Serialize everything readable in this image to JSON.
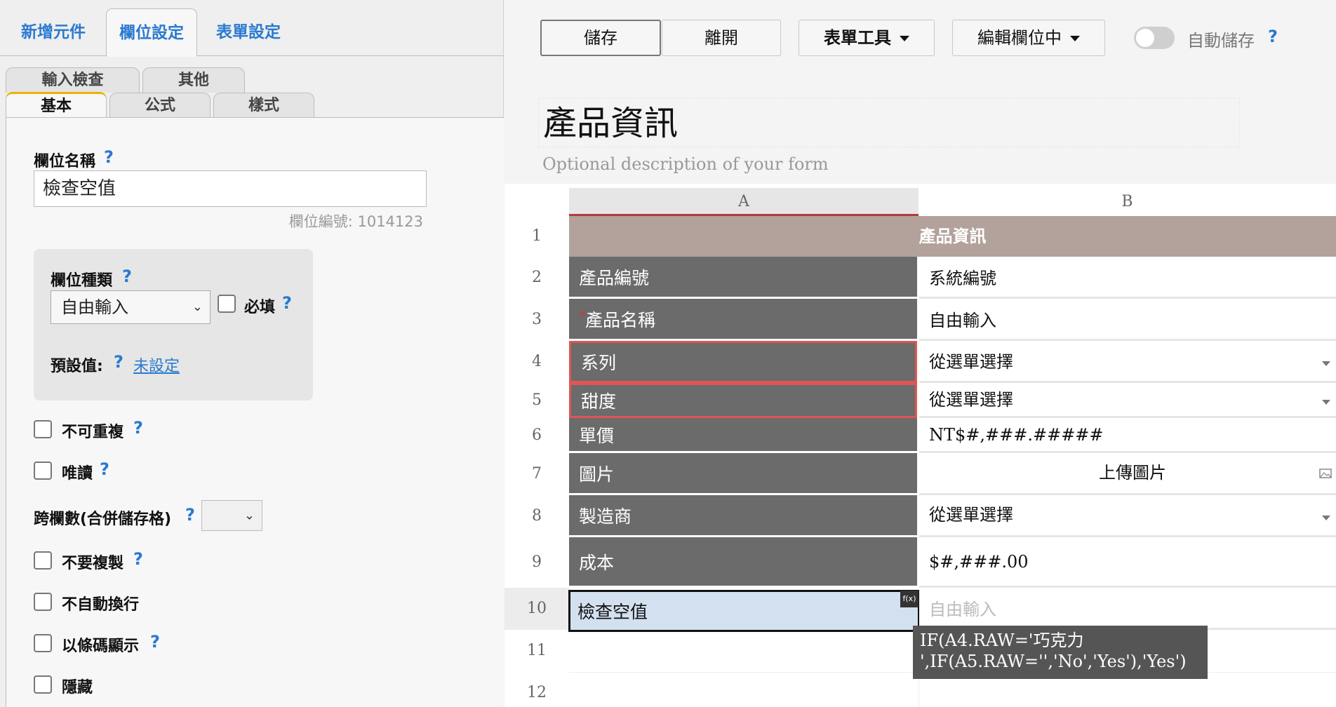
{
  "left_panel": {
    "top_tabs": [
      "新增元件",
      "欄位設定",
      "表單設定"
    ],
    "sub_tabs_row1": [
      "輸入檢查",
      "其他"
    ],
    "sub_tabs_row2": [
      "基本",
      "公式",
      "樣式"
    ],
    "field_name_label": "欄位名稱",
    "field_name_value": "檢查空值",
    "field_id": "欄位編號: 1014123",
    "field_type_label": "欄位種類",
    "field_type_value": "自由輸入",
    "required_label": "必填",
    "default_label": "預設值:",
    "default_value": "未設定",
    "checkboxes": [
      "不可重複",
      "唯讀"
    ],
    "colspan_label": "跨欄數(合併儲存格)",
    "checkboxes2": [
      "不要複製",
      "不自動換行",
      "以條碼顯示",
      "隱藏"
    ],
    "help": "?"
  },
  "toolbar": {
    "save": "儲存",
    "leave": "離開",
    "form_tools": "表單工具",
    "edit_mode": "編輯欄位中",
    "autosave": "自動儲存",
    "help": "?"
  },
  "form": {
    "title": "產品資訊",
    "description": "Optional description of your form"
  },
  "sheet": {
    "columns": [
      "A",
      "B"
    ],
    "header_row": "產品資訊",
    "rows": [
      {
        "num": "1"
      },
      {
        "num": "2",
        "a": "產品編號",
        "b": "系統編號"
      },
      {
        "num": "3",
        "a": "產品名稱",
        "b": "自由輸入",
        "required_mark": "*"
      },
      {
        "num": "4",
        "a": "系列",
        "b": "從選單選擇"
      },
      {
        "num": "5",
        "a": "甜度",
        "b": "從選單選擇"
      },
      {
        "num": "6",
        "a": "單價",
        "b": "NT$#,###.#####"
      },
      {
        "num": "7",
        "a": "圖片",
        "b": "上傳圖片"
      },
      {
        "num": "8",
        "a": "製造商",
        "b": "從選單選擇"
      },
      {
        "num": "9",
        "a": "成本",
        "b": "$#,###.00"
      },
      {
        "num": "10",
        "a": "檢查空值",
        "b": "自由輸入"
      },
      {
        "num": "11"
      },
      {
        "num": "12"
      }
    ],
    "fx_badge": "f(x)",
    "formula_line1": "IF(A4.RAW='巧克力",
    "formula_line2": "',IF(A5.RAW='','No','Yes'),'Yes')"
  },
  "colors": {
    "accent_blue": "#2a7ad0",
    "label_gray": "#6b6b6b",
    "header_brown": "#b2a29b",
    "highlight_red": "#e05555",
    "selected_cell": "#d3e0ef",
    "tab_indicator": "#f1b100"
  }
}
